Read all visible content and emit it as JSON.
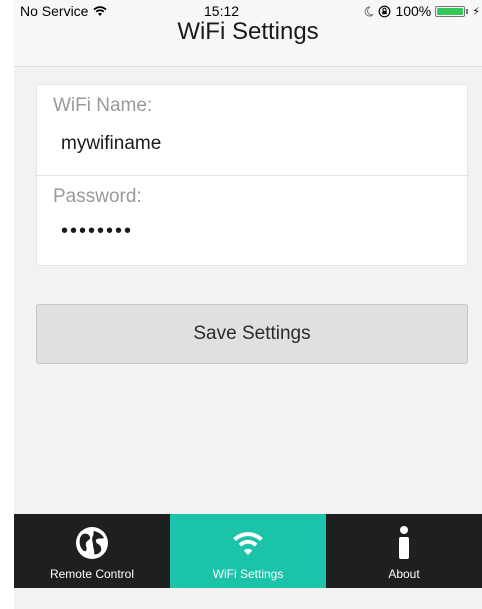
{
  "status_bar": {
    "carrier": "No Service",
    "time": "15:12",
    "battery": "100%",
    "battery_level": 1.0
  },
  "nav": {
    "title": "WiFi Settings"
  },
  "form": {
    "wifi_name_label": "WiFi Name:",
    "wifi_name_value": "mywifiname",
    "password_label": "Password:",
    "password_value": "••••••••"
  },
  "save_button": {
    "label": "Save Settings"
  },
  "tabs": [
    {
      "label": "Remote Control",
      "icon": "globe-icon",
      "active": false
    },
    {
      "label": "WiFi Settings",
      "icon": "wifi-icon",
      "active": true
    },
    {
      "label": "About",
      "icon": "info-icon",
      "active": false
    }
  ],
  "colors": {
    "tab_active": "#1bc3a8",
    "tab_bar": "#1f1f1f",
    "battery": "#34c759"
  }
}
